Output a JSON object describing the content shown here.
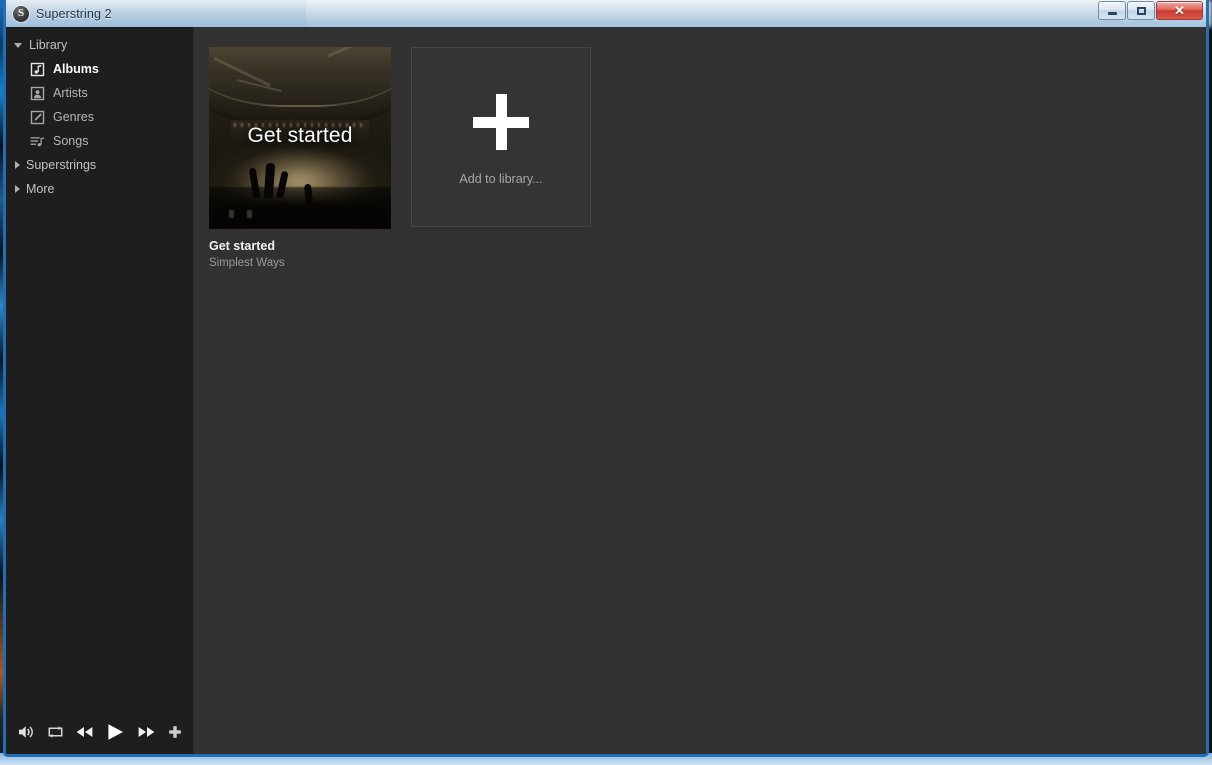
{
  "window": {
    "title": "Superstring 2",
    "app_icon": "superstring-logo-icon",
    "controls": {
      "minimize": "minimize-icon",
      "maximize": "maximize-icon",
      "close": "✕"
    }
  },
  "sidebar": {
    "groups": [
      {
        "label": "Library",
        "expanded": true,
        "twisty": "chevron-down-icon",
        "items": [
          {
            "label": "Albums",
            "icon": "albums-icon",
            "selected": true
          },
          {
            "label": "Artists",
            "icon": "artists-icon",
            "selected": false
          },
          {
            "label": "Genres",
            "icon": "genres-icon",
            "selected": false
          },
          {
            "label": "Songs",
            "icon": "songs-icon",
            "selected": false
          }
        ]
      },
      {
        "label": "Superstrings",
        "expanded": false,
        "twisty": "chevron-right-icon",
        "items": []
      },
      {
        "label": "More",
        "expanded": false,
        "twisty": "chevron-right-icon",
        "items": []
      }
    ]
  },
  "player": {
    "buttons": [
      {
        "name": "volume-icon",
        "title": "Volume"
      },
      {
        "name": "repeat-icon",
        "title": "Repeat"
      },
      {
        "name": "previous-icon",
        "title": "Previous"
      },
      {
        "name": "play-icon",
        "title": "Play"
      },
      {
        "name": "next-icon",
        "title": "Next"
      },
      {
        "name": "add-icon",
        "title": "Add"
      },
      {
        "name": "pin-icon",
        "title": "Pin"
      }
    ]
  },
  "content": {
    "albums": [
      {
        "art_overlay_text": "Get started",
        "title": "Get started",
        "artist": "Simplest Ways"
      }
    ],
    "add_card": {
      "icon": "plus-icon",
      "label": "Add to library..."
    }
  },
  "colors": {
    "sidebar_bg": "#1e1e1e",
    "content_bg": "#313131",
    "window_border": "#1f6fb8",
    "close_button": "#c73c2e",
    "selected_text": "#ffffff",
    "muted_text": "#9a9a9a"
  }
}
